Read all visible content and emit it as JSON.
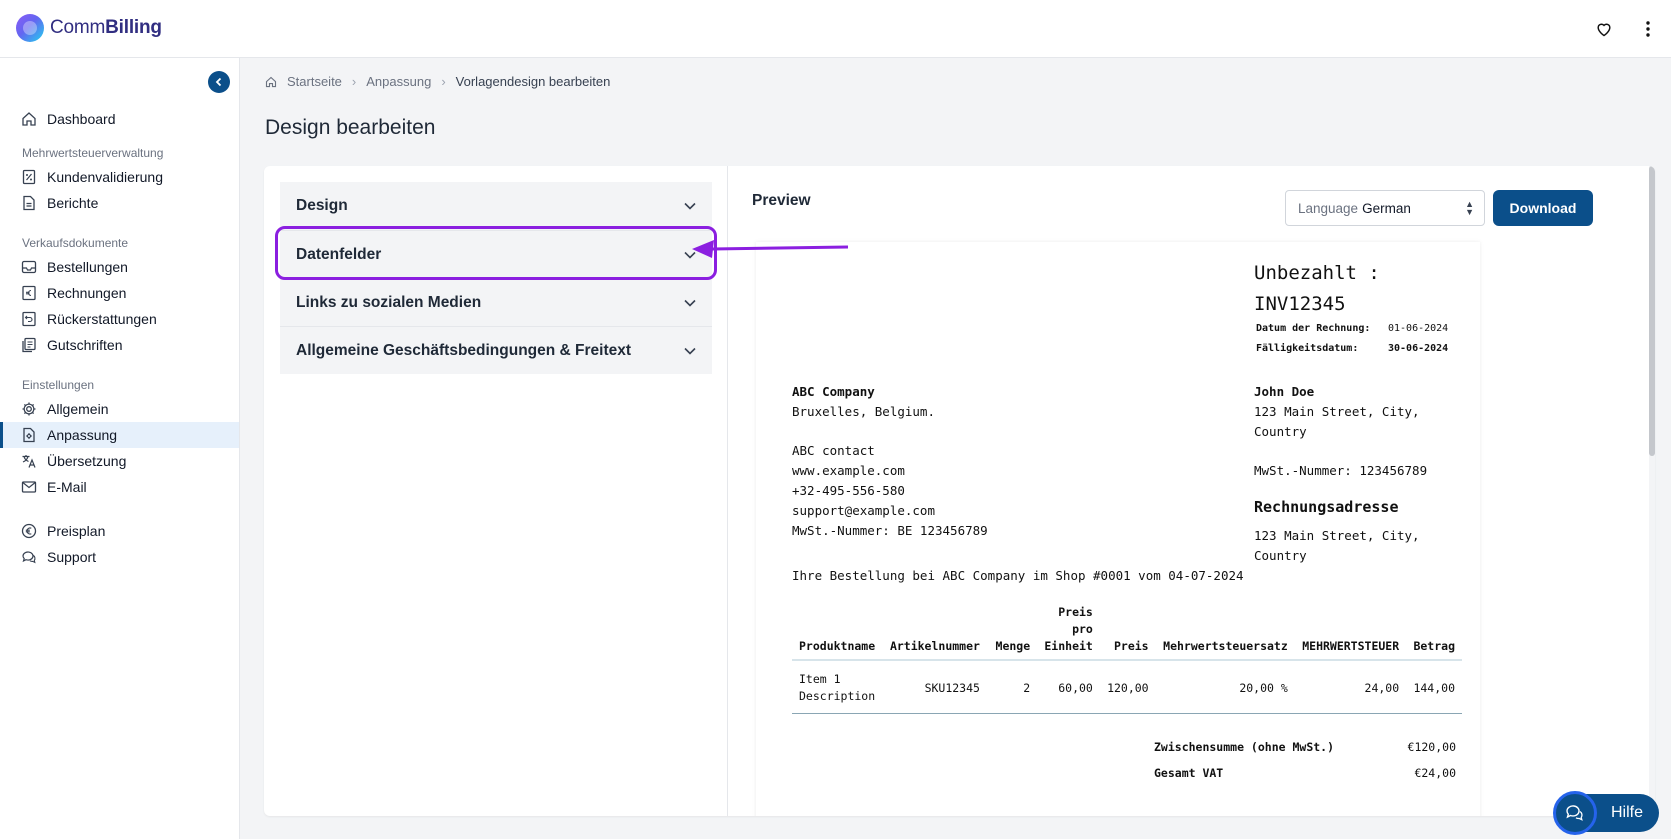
{
  "app": {
    "logo_part1": "Comm",
    "logo_part2": "Billing"
  },
  "breadcrumb": {
    "home": "Startseite",
    "parent": "Anpassung",
    "current": "Vorlagendesign bearbeiten"
  },
  "page": {
    "title": "Design bearbeiten"
  },
  "sidebar": {
    "items": [
      {
        "label": "Dashboard",
        "icon": "home-icon"
      },
      {
        "section": "Mehrwertsteuerverwaltung"
      },
      {
        "label": "Kundenvalidierung",
        "icon": "percent-icon"
      },
      {
        "label": "Berichte",
        "icon": "document-icon"
      },
      {
        "section": "Verkaufsdokumente"
      },
      {
        "label": "Bestellungen",
        "icon": "inbox-icon"
      },
      {
        "label": "Rechnungen",
        "icon": "euro-icon"
      },
      {
        "label": "Rückerstattungen",
        "icon": "refund-icon"
      },
      {
        "label": "Gutschriften",
        "icon": "copy-icon"
      },
      {
        "section": "Einstellungen"
      },
      {
        "label": "Allgemein",
        "icon": "gear-icon"
      },
      {
        "label": "Anpassung",
        "icon": "customize-icon",
        "active": true
      },
      {
        "label": "Übersetzung",
        "icon": "translate-icon"
      },
      {
        "label": "E-Mail",
        "icon": "mail-icon"
      },
      {
        "label": "Preisplan",
        "icon": "euro-circle-icon"
      },
      {
        "label": "Support",
        "icon": "chat-icon"
      }
    ]
  },
  "accordion": [
    {
      "label": "Design"
    },
    {
      "label": "Datenfelder"
    },
    {
      "label": "Links zu sozialen Medien"
    },
    {
      "label": "Allgemeine Geschäftsbedingungen & Freitext"
    }
  ],
  "preview": {
    "title": "Preview",
    "language_label": "Language",
    "language_value": "German",
    "download_label": "Download"
  },
  "invoice": {
    "status_line1": "Unbezahlt :",
    "status_line2": "INV12345",
    "date_label": "Datum der Rechnung:",
    "date_value": "01-06-2024",
    "due_label": "Fälligkeitsdatum:",
    "due_value": "30-06-2024",
    "seller": {
      "name": "ABC Company",
      "city": "Bruxelles, Belgium.",
      "contact": "ABC contact",
      "website": "www.example.com",
      "phone": "+32-495-556-580",
      "email": "support@example.com",
      "vat": "MwSt.-Nummer: BE 123456789"
    },
    "buyer": {
      "name": "John Doe",
      "address": "123 Main Street, City, Country",
      "vat": "MwSt.-Nummer: 123456789"
    },
    "billing_title": "Rechnungsadresse",
    "billing_address": "123 Main Street, City, Country",
    "order_line": "Ihre Bestellung bei ABC Company im Shop #0001 vom 04-07-2024",
    "columns": [
      "Produktname",
      "Artikelnummer",
      "Menge",
      "Preis pro Einheit",
      "Preis",
      "Mehrwertsteuersatz",
      "MEHRWERTSTEUER",
      "Betrag"
    ],
    "rows": [
      {
        "name": "Item 1 Description",
        "sku": "SKU12345",
        "qty": "2",
        "unit": "60,00",
        "price": "120,00",
        "vat_rate": "20,00 %",
        "vat": "24,00",
        "amount": "144,00"
      }
    ],
    "subtotal_label": "Zwischensumme (ohne MwSt.)",
    "subtotal_value": "€120,00",
    "vat_total_label": "Gesamt VAT",
    "vat_total_value": "€24,00"
  },
  "help": {
    "label": "Hilfe"
  },
  "colors": {
    "primary": "#0b4f8a",
    "highlight": "#8b1fe0",
    "active_nav_bg": "#e6f0fb"
  }
}
